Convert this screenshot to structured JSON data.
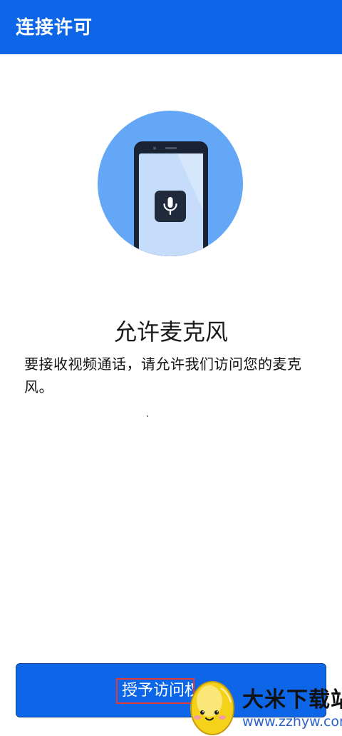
{
  "app_bar": {
    "title": "连接许可"
  },
  "illustration": {
    "icons": [
      "phone-icon",
      "microphone-icon"
    ],
    "colors": {
      "circle": "#64a7f6",
      "phone_body": "#1a2335",
      "phone_screen": "#c5ddfb",
      "mic_tile": "#1f2a3d"
    }
  },
  "permission": {
    "title": "允许麦克风",
    "description": "要接收视频通话，请允许我们访问您的麦克风。"
  },
  "action": {
    "grant_label": "授予访问权限"
  },
  "watermark": {
    "name": "大米下载站",
    "url": "www.zzhyw.com"
  },
  "colors": {
    "brand_blue": "#0d66e8",
    "highlight_box": "#e23a3a"
  }
}
